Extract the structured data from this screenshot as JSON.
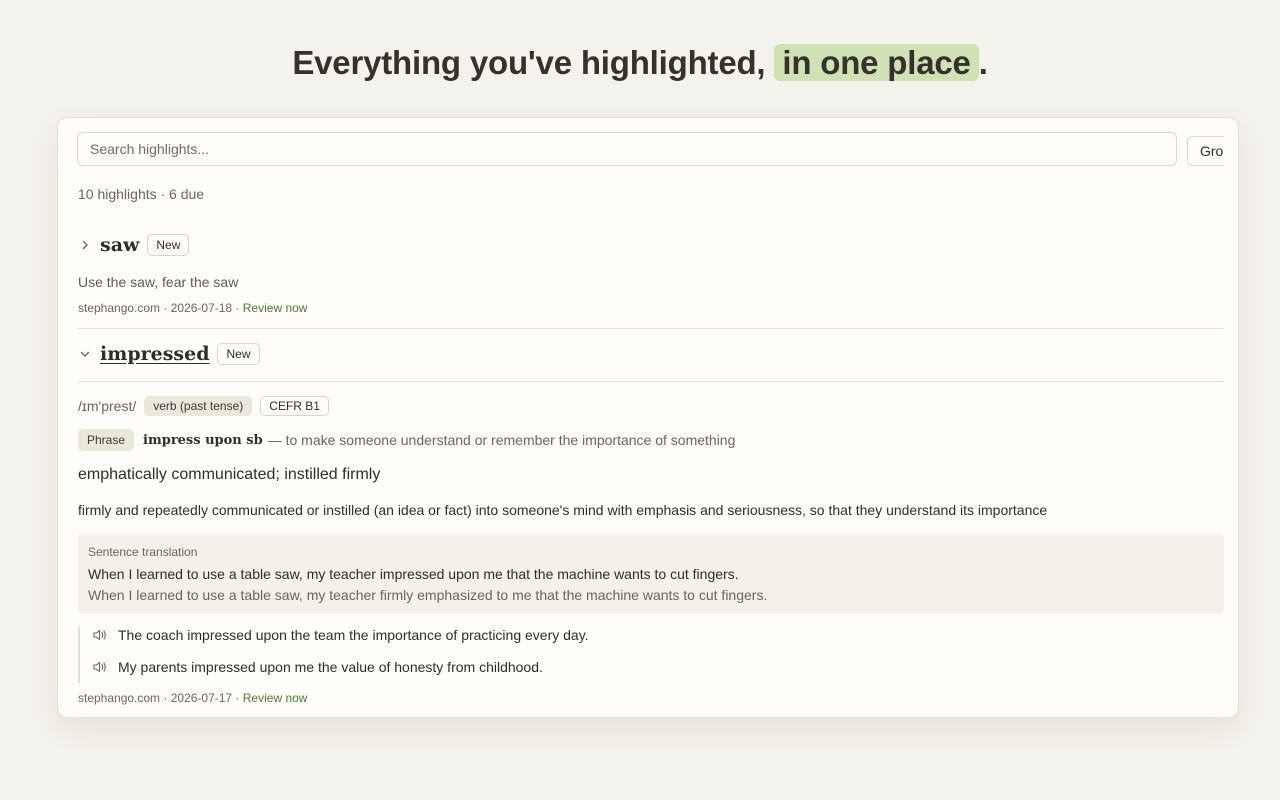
{
  "hero": {
    "prefix": "Everything you've highlighted, ",
    "highlight": "in one place",
    "suffix": "."
  },
  "search": {
    "placeholder": "Search highlights..."
  },
  "group_button": {
    "label": "Gro"
  },
  "summary": "10 highlights · 6 due",
  "entries": [
    {
      "word": "saw",
      "badge": "New",
      "expanded": false,
      "context": "Use the saw, fear the saw",
      "meta_prefix": "stephango.com · 2026-07-18 · ",
      "review": "Review now"
    },
    {
      "word": "impressed",
      "badge": "New",
      "expanded": true,
      "pronunciation": "/ɪm'prest/",
      "pos": "verb (past tense)",
      "cefr": "CEFR B1",
      "phrase_label": "Phrase",
      "phrase_term": "impress upon sb",
      "phrase_def": "— to make someone understand or remember the importance of something",
      "short_def": "emphatically communicated; instilled firmly",
      "long_def": "firmly and repeatedly communicated or instilled (an idea or fact) into someone's mind with emphasis and seriousness, so that they understand its importance",
      "translation_label": "Sentence translation",
      "translation_original": "When I learned to use a table saw, my teacher impressed upon me that the machine wants to cut fingers.",
      "translation_text": "When I learned to use a table saw, my teacher firmly emphasized to me that the machine wants to cut fingers.",
      "examples": [
        "The coach impressed upon the team the importance of practicing every day.",
        "My parents impressed upon me the value of honesty from childhood."
      ],
      "meta_prefix": "stephango.com · 2026-07-17 · ",
      "review": "Review now"
    }
  ],
  "icons": {
    "collapsed": "chevron-right-icon",
    "expanded": "chevron-down-icon",
    "audio": "speaker-icon"
  },
  "colors": {
    "highlight": "#cfe1b5",
    "review_link": "#4e7a2e",
    "background": "#f4f2ec"
  }
}
